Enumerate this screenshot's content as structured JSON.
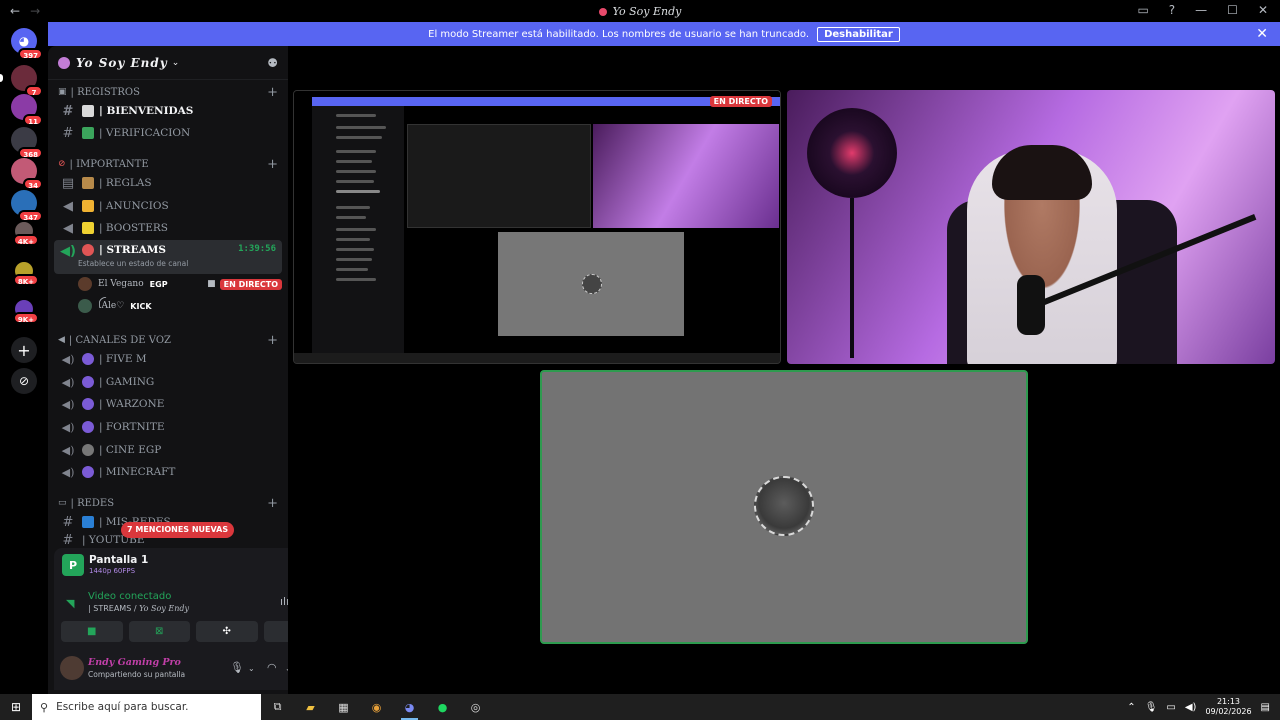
{
  "window": {
    "title": "Yo Soy Endy",
    "nav_back": "←",
    "nav_forward": "→"
  },
  "rail": {
    "servers": [
      {
        "name": "discord-home",
        "badge": "397"
      },
      {
        "name": "server-1",
        "badge": "7"
      },
      {
        "name": "server-2",
        "badge": "11"
      },
      {
        "name": "server-3",
        "badge": "368"
      },
      {
        "name": "server-4",
        "badge": "34"
      },
      {
        "name": "server-5",
        "badge": "347"
      },
      {
        "name": "server-6",
        "badge": "4K+"
      },
      {
        "name": "server-7",
        "badge": "8K+"
      },
      {
        "name": "server-8",
        "badge": "9K+"
      }
    ],
    "add_label": "+",
    "discover_label": "⊘"
  },
  "banner": {
    "text": "El modo Streamer está habilitado. Los nombres de usuario se han truncado.",
    "button": "Deshabilitar",
    "close": "✕"
  },
  "guild": {
    "name": "Yo Soy Endy",
    "categories": {
      "registros": "| REGISTROS",
      "importante": "| IMPORTANTE",
      "voz": "| CANALES DE VOZ",
      "redes": "| REDES"
    },
    "channels": {
      "bienvenidas": "| BIENVENIDAS",
      "verificacion": "| VERIFICACION",
      "reglas": "| REGLAS",
      "anuncios": "| ANUNCIOS",
      "boosters": "| BOOSTERS",
      "streams": "| STREAMS",
      "streams_timer": "1:39:56",
      "streams_status": "Establece un estado de canal",
      "mis_redes": "| MIS-REDES",
      "youtube": "| YOUTUBE"
    },
    "members": [
      {
        "name": "El Vegano",
        "tag": "EGP",
        "live": "EN DIRECTO"
      },
      {
        "name": "ꪶAle♡",
        "tag": "KICK"
      }
    ],
    "voice_channels": [
      "| FIVE M",
      "| GAMING",
      "| WARZONE",
      "| FORTNITE",
      "| CINE EGP",
      "| MINECRAFT"
    ],
    "mentions": "7 MENCIONES NUEVAS"
  },
  "rtc": {
    "screen_title": "Pantalla 1",
    "quality": "1440p 60FPS",
    "status": "Video conectado",
    "channel": "| STREAMS /",
    "server": "Yo Soy Endy"
  },
  "user": {
    "name": "Endy Gaming Pro",
    "status": "Compartiendo su pantalla"
  },
  "stage": {
    "live_badge": "EN DIRECTO"
  },
  "taskbar": {
    "search_placeholder": "Escribe aquí para buscar.",
    "time": "21:13",
    "date": "09/02/2026"
  },
  "colors": {
    "blurple": "#5865f2",
    "live_red": "#da373c",
    "online_green": "#23a55a"
  }
}
